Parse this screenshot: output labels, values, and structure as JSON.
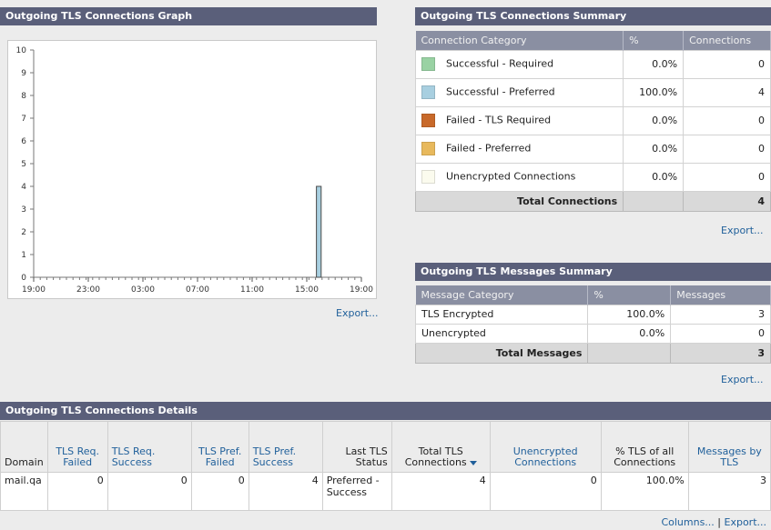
{
  "graph": {
    "title": "Outgoing TLS Connections Graph",
    "export_label": "Export...",
    "chart_data": {
      "type": "bar",
      "x_ticks": [
        "19:00",
        "23:00",
        "03:00",
        "07:00",
        "11:00",
        "15:00",
        "19:00"
      ],
      "y_ticks": [
        0,
        1,
        2,
        3,
        4,
        5,
        6,
        7,
        8,
        9,
        10
      ],
      "ylim": [
        0,
        10
      ],
      "grid": false,
      "series": [
        {
          "color": "#a8cfe0",
          "values": [
            0,
            0,
            0,
            0,
            0,
            0,
            0,
            0,
            0,
            0,
            0,
            0,
            0,
            0,
            0,
            0,
            0,
            0,
            0,
            0,
            0,
            0,
            0,
            0,
            0,
            0,
            0,
            0,
            0,
            0,
            0,
            0,
            0,
            0,
            0,
            0,
            0,
            0,
            0,
            0,
            0,
            0,
            0,
            4,
            0,
            0,
            0,
            0,
            0,
            0
          ]
        }
      ]
    }
  },
  "conn_summary": {
    "title": "Outgoing TLS Connections Summary",
    "headers": [
      "Connection Category",
      "%",
      "Connections"
    ],
    "rows": [
      {
        "label": "Successful - Required",
        "color": "#99d2a3",
        "pct": "0.0%",
        "count": "0"
      },
      {
        "label": "Successful - Preferred",
        "color": "#a8cfe0",
        "pct": "100.0%",
        "count": "4"
      },
      {
        "label": "Failed - TLS Required",
        "color": "#c8692a",
        "pct": "0.0%",
        "count": "0"
      },
      {
        "label": "Failed - Preferred",
        "color": "#e8b95c",
        "pct": "0.0%",
        "count": "0"
      },
      {
        "label": "Unencrypted Connections",
        "color": "#fbfbee",
        "pct": "0.0%",
        "count": "0"
      }
    ],
    "total_label": "Total Connections",
    "total_count": "4",
    "export_label": "Export..."
  },
  "msg_summary": {
    "title": "Outgoing TLS Messages Summary",
    "headers": [
      "Message Category",
      "%",
      "Messages"
    ],
    "rows": [
      {
        "label": "TLS Encrypted",
        "pct": "100.0%",
        "count": "3"
      },
      {
        "label": "Unencrypted",
        "pct": "0.0%",
        "count": "0"
      }
    ],
    "total_label": "Total Messages",
    "total_count": "3",
    "export_label": "Export..."
  },
  "details": {
    "title": "Outgoing TLS Connections Details",
    "headers": [
      "Domain",
      "TLS Req. Failed",
      "TLS Req. Success",
      "TLS Pref. Failed",
      "TLS Pref. Success",
      "Last TLS Status",
      "Total TLS Connections",
      "Unencrypted Connections",
      "% TLS of all Connections",
      "Messages by TLS"
    ],
    "rows": [
      {
        "domain": "mail.qa",
        "req_failed": "0",
        "req_success": "0",
        "pref_failed": "0",
        "pref_success": "4",
        "last_status": "Preferred - Success",
        "total": "4",
        "unencrypted": "0",
        "pct_tls": "100.0%",
        "messages": "3"
      }
    ],
    "columns_label": "Columns...",
    "separator": " | ",
    "export_label": "Export..."
  }
}
